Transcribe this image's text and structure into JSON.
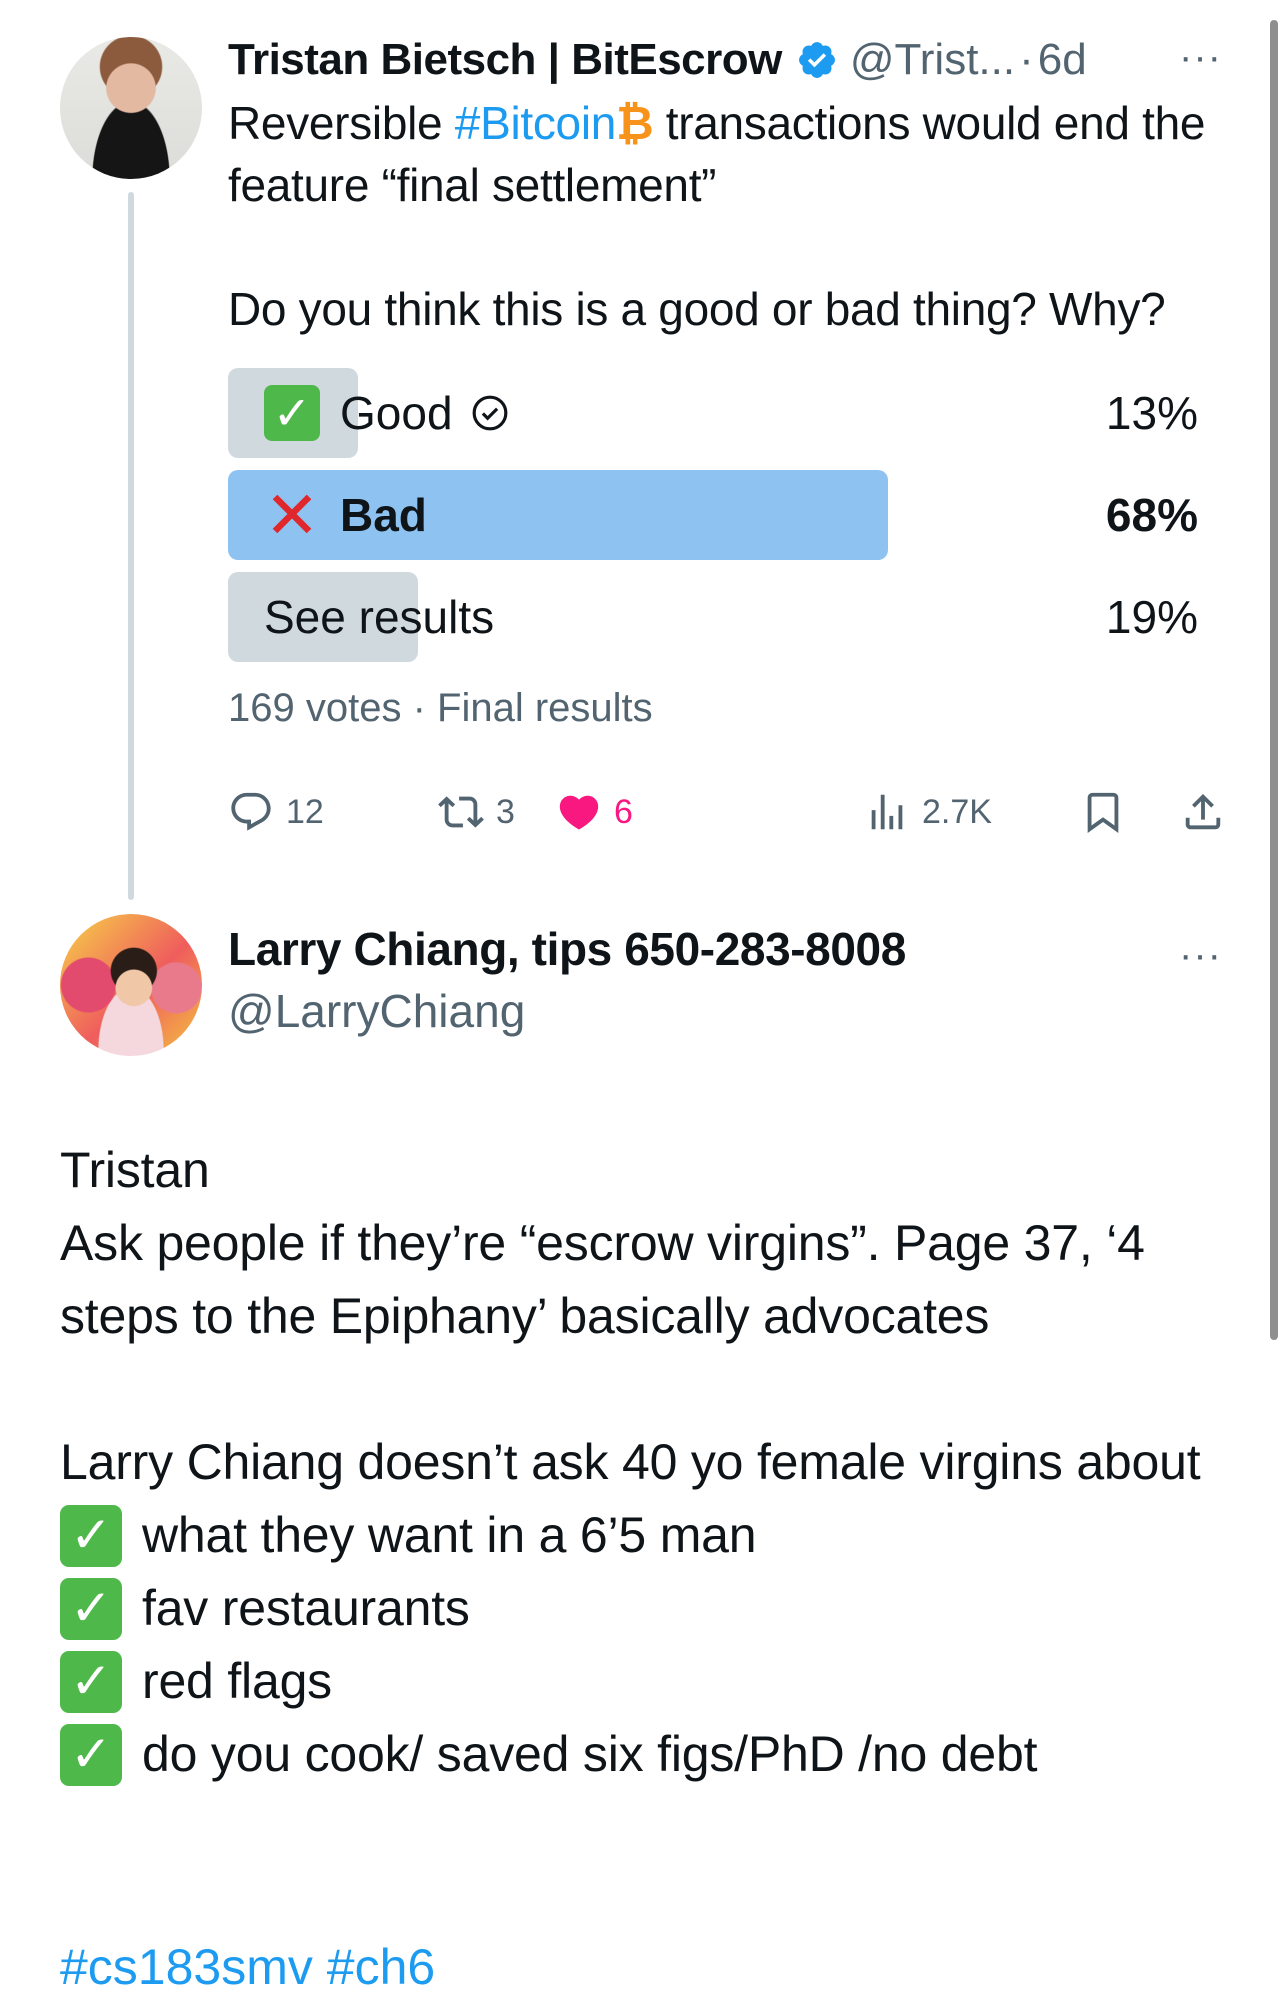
{
  "tweet": {
    "author_name": "Tristan Bietsch | BitEscrow",
    "handle": "@Trist...",
    "separator": "·",
    "time": "6d",
    "more": "···",
    "text_part1": "Reversible ",
    "hashtag_bitcoin": "#Bitcoin",
    "bitcoin_symbol": "₿",
    "text_part2": " transactions would end the feature “final settlement”",
    "question": "Do you think this is a good or bad thing? Why?",
    "poll": {
      "options": [
        {
          "label": "Good",
          "percent_text": "13%",
          "percent": 13,
          "emoji": "✓",
          "chosen": true,
          "winner": false
        },
        {
          "label": "Bad",
          "percent_text": "68%",
          "percent": 68,
          "emoji": "✕",
          "chosen": false,
          "winner": true
        },
        {
          "label": "See results",
          "percent_text": "19%",
          "percent": 19,
          "emoji": "",
          "chosen": false,
          "winner": false
        }
      ],
      "meta": "169 votes · Final results"
    },
    "actions": {
      "replies": "12",
      "retweets": "3",
      "likes": "6",
      "views": "2.7K"
    }
  },
  "reply": {
    "author_name": "Larry Chiang, tips 650-283-8008",
    "handle": "@LarryChiang",
    "more": "···",
    "line1": "Tristan",
    "line2": "Ask people if they’re “escrow virgins”. Page 37, ‘4 steps to the Epiphany’ basically advocates",
    "line3": "Larry Chiang doesn’t ask 40 yo female virgins about",
    "checks": [
      "what they want in a 6’5 man",
      "fav restaurants",
      "red flags",
      "do you cook/ saved six figs/PhD /no debt"
    ],
    "check_mark": "✓",
    "tags": "#cs183smv #ch6"
  },
  "colors": {
    "accent": "#1d9bf0",
    "like": "#f91880",
    "poll_winner": "#8ec3f1",
    "poll_other": "#cfd9de",
    "check_green": "#4fb84a",
    "x_red": "#e0272b"
  }
}
